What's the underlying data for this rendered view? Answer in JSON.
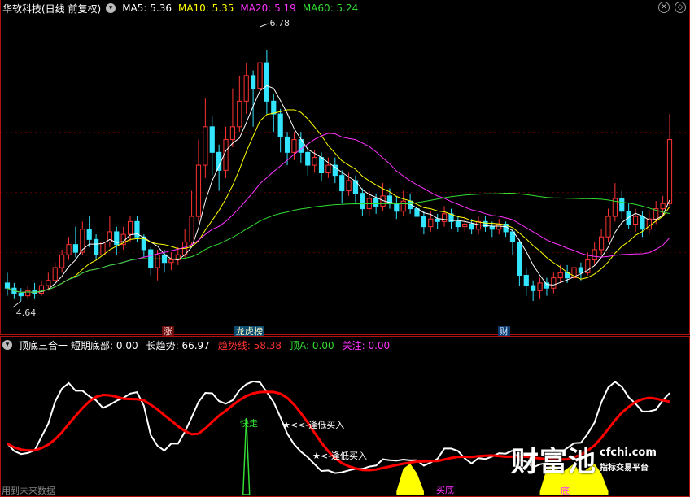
{
  "main": {
    "title": "华软科技(日线 前复权)",
    "ma_labels": [
      {
        "text": "MA5: 5.36",
        "color": "#ffffff"
      },
      {
        "text": "MA10: 5.35",
        "color": "#ffff00"
      },
      {
        "text": "MA20: 5.19",
        "color": "#ff33ff"
      },
      {
        "text": "MA60: 5.24",
        "color": "#33dd33"
      }
    ],
    "high_label": "6.78",
    "low_label": "4.64",
    "event_tags": [
      "涨",
      "龙虎榜",
      "财"
    ]
  },
  "indicator": {
    "title": "顶底三合一",
    "values": [
      {
        "text": "短期底部: 0.00",
        "color": "#ffffff"
      },
      {
        "text": "长趋势: 66.97",
        "color": "#ffffff"
      },
      {
        "text": "趋势线: 58.38",
        "color": "#ff3333"
      },
      {
        "text": "顶A: 0.00",
        "color": "#33dd33"
      },
      {
        "text": "关注: 0.00",
        "color": "#ff33ff"
      }
    ],
    "annotations": {
      "fast_run": "快走",
      "buy1": "★<<-逢低买入",
      "buy2": "★<-逢低买入",
      "buy_bottom": "买底",
      "bottom2": "底"
    },
    "footer": "用到未来数据"
  },
  "watermark": {
    "main": "财富池",
    "url": "cfchi.com",
    "sub": "指标交易平台"
  },
  "colors": {
    "up": "#ff3333",
    "down": "#33e5ff",
    "ma5": "#ffffff",
    "ma10": "#ffff00",
    "ma20": "#ff33ff",
    "ma60": "#33dd33",
    "border": "#b01010"
  },
  "candles": [
    [
      4.78,
      4.74,
      4.86,
      4.68
    ],
    [
      4.74,
      4.7,
      4.78,
      4.66
    ],
    [
      4.7,
      4.68,
      4.74,
      4.64
    ],
    [
      4.68,
      4.72,
      4.76,
      4.66
    ],
    [
      4.72,
      4.7,
      4.78,
      4.66
    ],
    [
      4.7,
      4.76,
      4.8,
      4.68
    ],
    [
      4.76,
      4.8,
      4.86,
      4.72
    ],
    [
      4.8,
      4.9,
      4.94,
      4.78
    ],
    [
      4.9,
      5.0,
      5.04,
      4.86
    ],
    [
      5.0,
      5.08,
      5.14,
      4.96
    ],
    [
      5.08,
      5.02,
      5.22,
      4.98
    ],
    [
      5.02,
      5.2,
      5.26,
      5.0
    ],
    [
      5.2,
      5.12,
      5.3,
      5.06
    ],
    [
      5.12,
      5.0,
      5.16,
      4.96
    ],
    [
      5.0,
      5.1,
      5.14,
      4.96
    ],
    [
      5.1,
      5.18,
      5.3,
      5.06
    ],
    [
      5.18,
      5.08,
      5.22,
      5.0
    ],
    [
      5.08,
      5.16,
      5.22,
      5.04
    ],
    [
      5.16,
      5.26,
      5.3,
      5.1
    ],
    [
      5.26,
      5.14,
      5.3,
      5.1
    ],
    [
      5.14,
      5.04,
      5.16,
      4.98
    ],
    [
      5.04,
      4.9,
      5.06,
      4.84
    ],
    [
      4.9,
      5.0,
      5.04,
      4.8
    ],
    [
      5.0,
      4.94,
      5.04,
      4.86
    ],
    [
      4.94,
      4.96,
      5.02,
      4.88
    ],
    [
      4.96,
      5.0,
      5.06,
      4.92
    ],
    [
      5.0,
      5.1,
      5.2,
      4.98
    ],
    [
      5.1,
      5.3,
      5.5,
      5.08
    ],
    [
      5.3,
      5.7,
      5.9,
      5.26
    ],
    [
      5.7,
      6.0,
      6.22,
      5.6
    ],
    [
      6.0,
      5.8,
      6.08,
      5.62
    ],
    [
      5.8,
      5.66,
      5.86,
      5.5
    ],
    [
      5.66,
      5.9,
      6.0,
      5.6
    ],
    [
      5.9,
      6.0,
      6.3,
      5.84
    ],
    [
      6.0,
      6.2,
      6.4,
      5.96
    ],
    [
      6.2,
      6.4,
      6.5,
      6.1
    ],
    [
      6.4,
      6.3,
      6.44,
      6.0
    ],
    [
      6.3,
      6.5,
      6.78,
      6.24
    ],
    [
      6.5,
      6.2,
      6.6,
      6.1
    ],
    [
      6.2,
      6.1,
      6.26,
      5.96
    ],
    [
      6.1,
      5.92,
      6.14,
      5.8
    ],
    [
      5.92,
      5.8,
      5.96,
      5.7
    ],
    [
      5.8,
      5.9,
      5.96,
      5.74
    ],
    [
      5.9,
      5.8,
      5.96,
      5.72
    ],
    [
      5.8,
      5.7,
      5.84,
      5.62
    ],
    [
      5.7,
      5.76,
      5.82,
      5.64
    ],
    [
      5.76,
      5.64,
      5.8,
      5.58
    ],
    [
      5.64,
      5.7,
      5.76,
      5.6
    ],
    [
      5.7,
      5.62,
      5.76,
      5.56
    ],
    [
      5.62,
      5.5,
      5.66,
      5.4
    ],
    [
      5.5,
      5.58,
      5.64,
      5.46
    ],
    [
      5.58,
      5.48,
      5.62,
      5.4
    ],
    [
      5.48,
      5.36,
      5.52,
      5.3
    ],
    [
      5.36,
      5.44,
      5.5,
      5.3
    ],
    [
      5.44,
      5.38,
      5.48,
      5.32
    ],
    [
      5.38,
      5.46,
      5.56,
      5.34
    ],
    [
      5.46,
      5.4,
      5.52,
      5.36
    ],
    [
      5.4,
      5.34,
      5.46,
      5.28
    ],
    [
      5.34,
      5.42,
      5.5,
      5.3
    ],
    [
      5.42,
      5.36,
      5.48,
      5.32
    ],
    [
      5.36,
      5.3,
      5.4,
      5.24
    ],
    [
      5.3,
      5.22,
      5.34,
      5.16
    ],
    [
      5.22,
      5.28,
      5.34,
      5.18
    ],
    [
      5.28,
      5.26,
      5.32,
      5.2
    ],
    [
      5.26,
      5.32,
      5.38,
      5.22
    ],
    [
      5.32,
      5.26,
      5.36,
      5.2
    ],
    [
      5.26,
      5.22,
      5.3,
      5.18
    ],
    [
      5.22,
      5.24,
      5.3,
      5.18
    ],
    [
      5.24,
      5.2,
      5.28,
      5.16
    ],
    [
      5.2,
      5.26,
      5.3,
      5.16
    ],
    [
      5.26,
      5.22,
      5.3,
      5.18
    ],
    [
      5.22,
      5.2,
      5.26,
      5.14
    ],
    [
      5.2,
      5.24,
      5.28,
      5.16
    ],
    [
      5.24,
      5.18,
      5.26,
      5.14
    ],
    [
      5.18,
      5.1,
      5.2,
      5.0
    ],
    [
      5.1,
      4.84,
      5.12,
      4.76
    ],
    [
      4.84,
      4.76,
      4.9,
      4.68
    ],
    [
      4.76,
      4.72,
      4.8,
      4.64
    ],
    [
      4.72,
      4.78,
      4.82,
      4.66
    ],
    [
      4.78,
      4.74,
      4.82,
      4.68
    ],
    [
      4.74,
      4.82,
      4.86,
      4.7
    ],
    [
      4.82,
      4.86,
      4.92,
      4.78
    ],
    [
      4.86,
      4.82,
      4.92,
      4.78
    ],
    [
      4.82,
      4.9,
      4.96,
      4.78
    ],
    [
      4.9,
      4.86,
      4.94,
      4.8
    ],
    [
      4.86,
      4.96,
      5.02,
      4.84
    ],
    [
      4.96,
      5.04,
      5.1,
      4.92
    ],
    [
      5.04,
      5.14,
      5.2,
      5.0
    ],
    [
      5.14,
      5.3,
      5.36,
      5.1
    ],
    [
      5.3,
      5.44,
      5.56,
      5.26
    ],
    [
      5.44,
      5.34,
      5.5,
      5.28
    ],
    [
      5.34,
      5.24,
      5.4,
      5.2
    ],
    [
      5.24,
      5.3,
      5.36,
      5.18
    ],
    [
      5.3,
      5.2,
      5.34,
      5.14
    ],
    [
      5.2,
      5.28,
      5.34,
      5.16
    ],
    [
      5.28,
      5.36,
      5.42,
      5.24
    ],
    [
      5.36,
      5.4,
      5.46,
      5.3
    ],
    [
      5.4,
      5.9,
      6.1,
      5.38
    ]
  ]
}
